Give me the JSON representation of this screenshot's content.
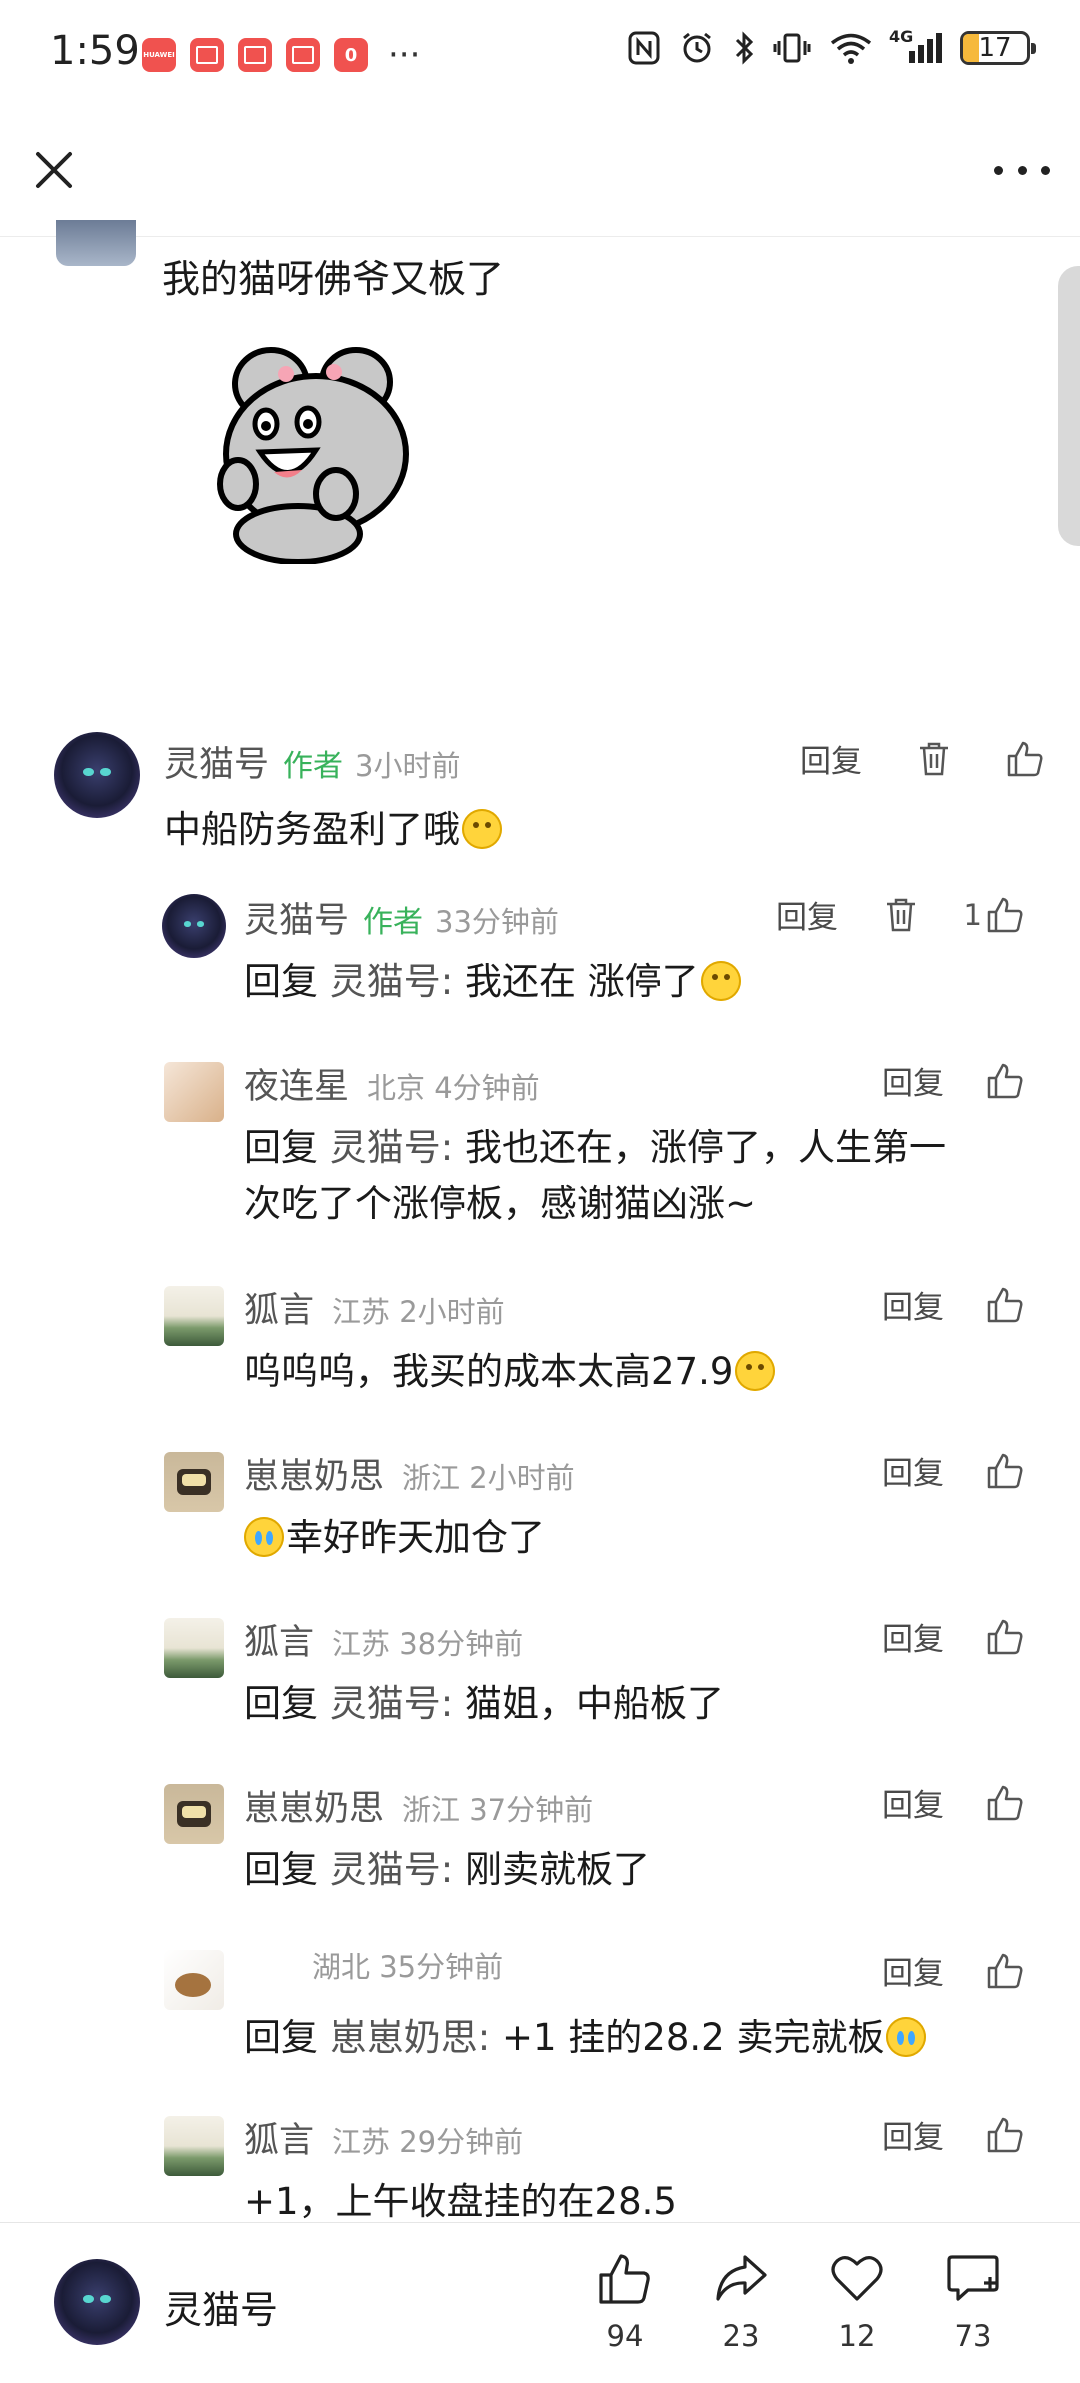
{
  "status_bar": {
    "time": "1:59",
    "app_icons": [
      "huawei-app-icon",
      "book-app-icon",
      "book-app-icon",
      "book-app-icon",
      "notification-app-icon"
    ],
    "huawei_label": "HUAWEI",
    "badge_number": "0",
    "more": "···",
    "network": "4G",
    "battery": "17"
  },
  "previous_comment": {
    "text": "我的猫呀佛爷又板了",
    "sticker": "mouse-sticker"
  },
  "comments": [
    {
      "name": "灵猫号",
      "author_tag": "作者",
      "meta": "3小时前",
      "reply_to": "",
      "text": "中船防务盈利了哦",
      "emoji": "smile",
      "reply_label": "回复",
      "has_delete": true,
      "likes": ""
    },
    {
      "name": "灵猫号",
      "author_tag": "作者",
      "meta": "33分钟前",
      "reply_prefix": "回复",
      "reply_to": "灵猫号:",
      "text": "我还在 涨停了",
      "emoji": "angry",
      "reply_label": "回复",
      "has_delete": true,
      "likes": "1"
    },
    {
      "name": "夜连星",
      "author_tag": "",
      "meta": "北京 4分钟前",
      "reply_prefix": "回复",
      "reply_to": "灵猫号:",
      "text": "我也还在，涨停了，人生第一",
      "text_line2": "次吃了个涨停板，感谢猫凶涨~",
      "reply_label": "回复",
      "has_delete": false,
      "likes": ""
    },
    {
      "name": "狐言",
      "author_tag": "",
      "meta": "江苏 2小时前",
      "reply_to": "",
      "text": "呜呜呜，我买的成本太高27.9",
      "emoji": "sad",
      "reply_label": "回复",
      "has_delete": false,
      "likes": ""
    },
    {
      "name": "崽崽奶思",
      "author_tag": "",
      "meta": "浙江 2小时前",
      "reply_to": "",
      "text": "幸好昨天加仓了",
      "emoji_before": "cry",
      "reply_label": "回复",
      "has_delete": false,
      "likes": ""
    },
    {
      "name": "狐言",
      "author_tag": "",
      "meta": "江苏 38分钟前",
      "reply_prefix": "回复",
      "reply_to": "灵猫号:",
      "text": "猫姐，中船板了",
      "reply_label": "回复",
      "has_delete": false,
      "likes": ""
    },
    {
      "name": "崽崽奶思",
      "author_tag": "",
      "meta": "浙江 37分钟前",
      "reply_prefix": "回复",
      "reply_to": "灵猫号:",
      "text": "刚卖就板了",
      "reply_label": "回复",
      "has_delete": false,
      "likes": ""
    },
    {
      "name": "",
      "author_tag": "",
      "meta": "湖北 35分钟前",
      "reply_prefix": "回复",
      "reply_to": "崽崽奶思:",
      "text": "+1 挂的28.2 卖完就板",
      "emoji": "cry",
      "reply_label": "回复",
      "has_delete": false,
      "likes": ""
    },
    {
      "name": "狐言",
      "author_tag": "",
      "meta": "江苏 29分钟前",
      "reply_to": "",
      "text": "+1，上午收盘挂的在28.5",
      "reply_label": "回复",
      "has_delete": false,
      "likes": ""
    }
  ],
  "bottom_bar": {
    "name": "灵猫号",
    "like_count": "94",
    "share_count": "23",
    "favorite_count": "12",
    "comment_count": "73"
  }
}
